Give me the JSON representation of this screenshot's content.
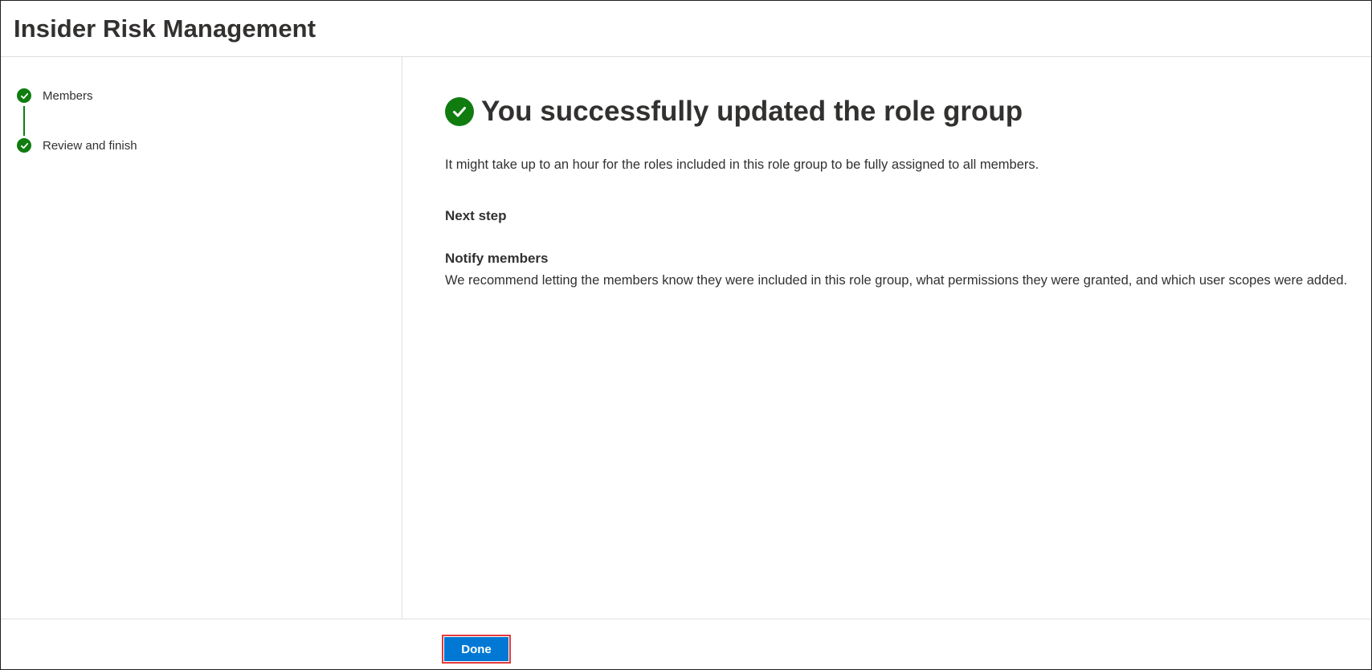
{
  "app": {
    "title": "Insider Risk Management"
  },
  "steps": [
    {
      "label": "Members",
      "status": "completed",
      "icon": "checkmark-icon"
    },
    {
      "label": "Review and finish",
      "status": "completed",
      "icon": "checkmark-icon"
    }
  ],
  "main": {
    "success_title": "You successfully updated the role group",
    "success_icon": "checkmark-circle-icon",
    "description": "It might take up to an hour for the roles included in this role group to be fully assigned to all members.",
    "next_step_heading": "Next step",
    "notify_title": "Notify members",
    "notify_body": "We recommend letting the members know they were included in this role group, what permissions they were granted, and which user scopes were added."
  },
  "footer": {
    "done_label": "Done"
  },
  "colors": {
    "success": "#107c10",
    "primary": "#0078d4",
    "highlight": "#e33a3a",
    "text": "#323130",
    "divider": "#e1dfdd"
  }
}
